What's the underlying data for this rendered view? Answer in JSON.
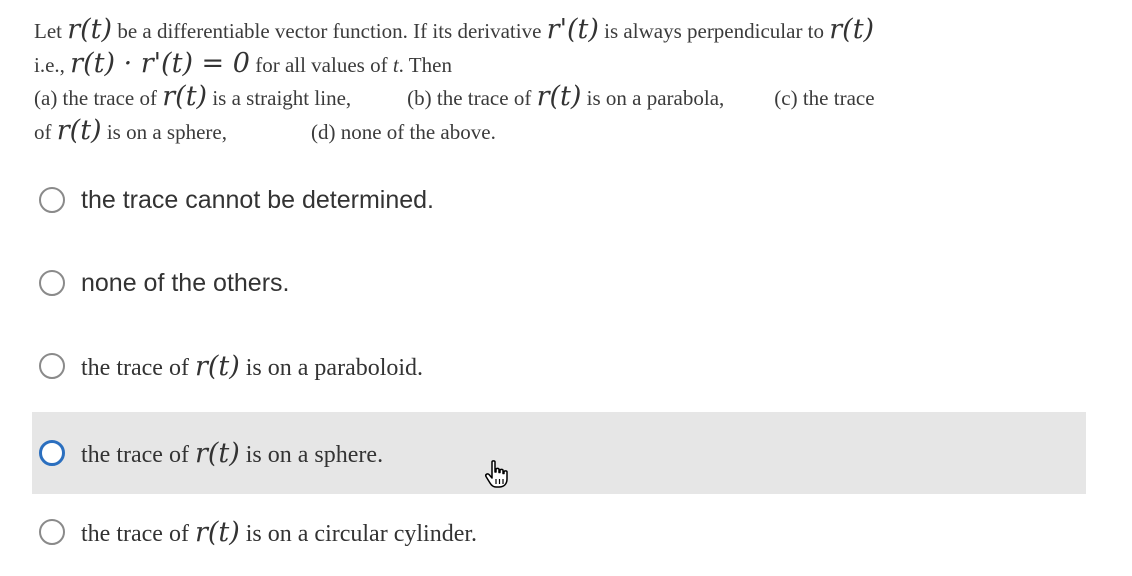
{
  "question": {
    "line1": {
      "p1": "Let ",
      "rt1": "r(t)",
      "p2": " be a differentiable vector function. If its derivative ",
      "rpt1": "r'(t)",
      "p3": " is always perpendicular to ",
      "rt2": "r(t)"
    },
    "line2": {
      "p1": "i.e., ",
      "expr": "r(t) · r'(t) = 0",
      "p2": " for all values of ",
      "var": "t",
      "p3": ". Then"
    },
    "line3": {
      "a_text": "(a) the trace of ",
      "a_math": "r(t)",
      "a_rest": " is a straight line,",
      "b_text": "(b) the trace of ",
      "b_math": "r(t)",
      "b_rest": " is on a parabola,",
      "c_text": "(c) the trace"
    },
    "line4": {
      "c_cont": "of ",
      "c_math": "r(t)",
      "c_rest": " is on a sphere,",
      "d_text": "(d) none of the above."
    }
  },
  "options": [
    {
      "text": "the trace cannot be determined."
    },
    {
      "text": "none of the others."
    },
    {
      "prefix": "the trace of ",
      "math": "r(t)",
      "suffix": " is on a paraboloid."
    },
    {
      "prefix": "the trace of ",
      "math": "r(t)",
      "suffix": " is on a sphere.",
      "hovered": true
    },
    {
      "prefix": "the trace of ",
      "math": "r(t)",
      "suffix": " is on a circular cylinder."
    }
  ],
  "icons": {
    "radio": "radio-circle-icon",
    "cursor": "hand-pointer-icon"
  },
  "colors": {
    "hover_bg": "#e6e6e6",
    "focus_radio": "#2b6fbf",
    "radio_border": "#8a8a8a"
  }
}
